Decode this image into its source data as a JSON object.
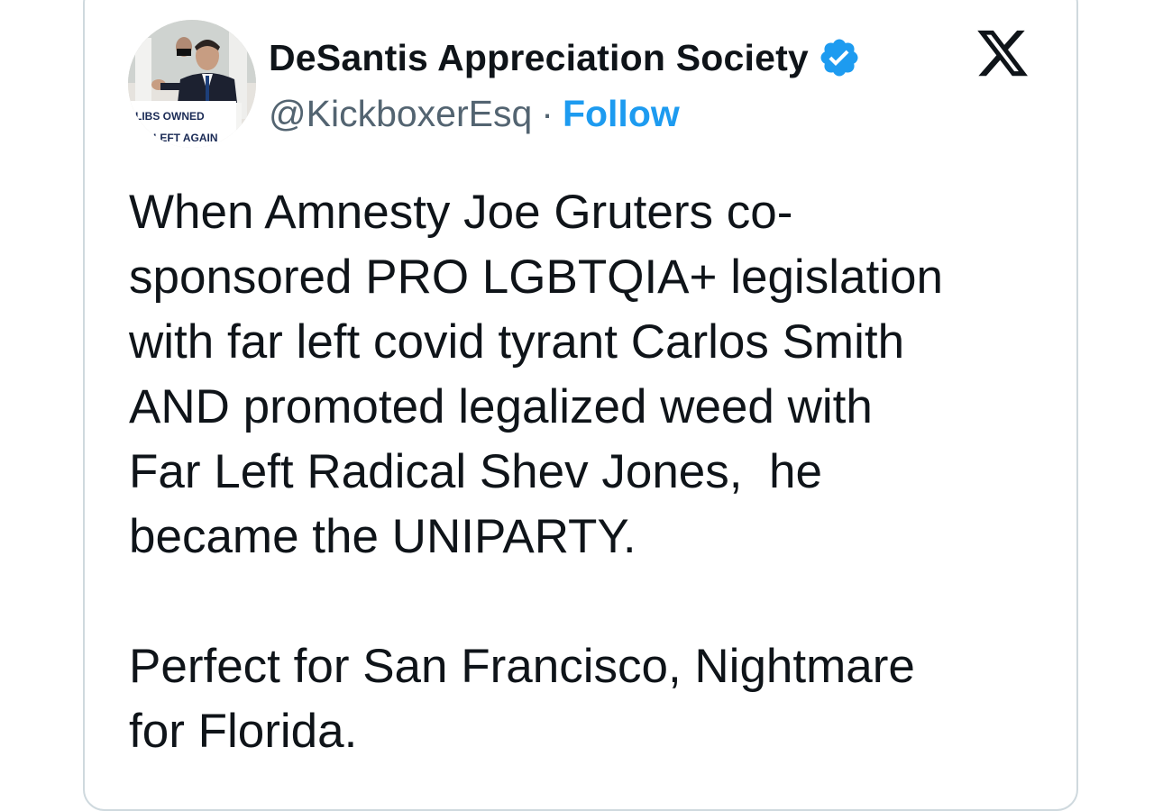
{
  "account": {
    "display_name": "DeSantis Appreciation Society",
    "handle": "@KickboxerEsq",
    "separator": "·",
    "follow_label": "Follow",
    "verified": true,
    "verified_color": "#1d9bf0",
    "avatar_sign_line1": "LIBS OWNED",
    "avatar_sign_line2": "LEFT AGAIN"
  },
  "brand": {
    "logo_icon": "x-logo-icon"
  },
  "tweet": {
    "text": "When Amnesty Joe Gruters co-\nsponsored PRO LGBTQIA+ legislation\nwith far left covid tyrant Carlos Smith\nAND promoted legalized weed with\nFar Left Radical Shev Jones,  he\nbecame the UNIPARTY.\n\nPerfect for San Francisco, Nightmare\nfor Florida."
  },
  "colors": {
    "text_primary": "#0f1419",
    "text_secondary": "#536471",
    "accent": "#1d9bf0",
    "border": "#cfd9de"
  }
}
